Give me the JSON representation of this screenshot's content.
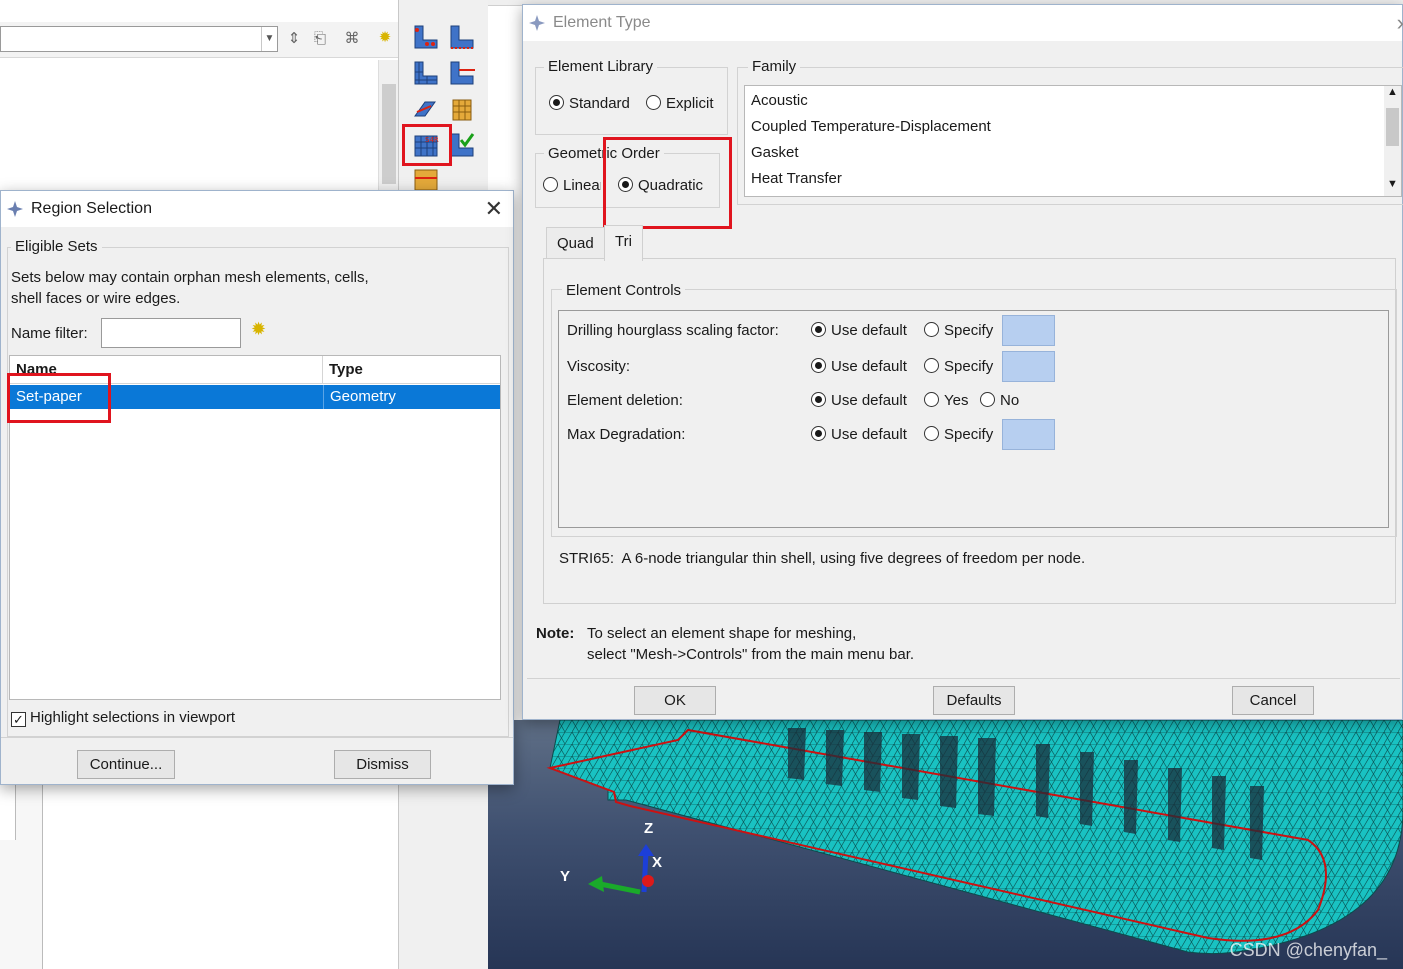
{
  "region_dialog": {
    "title": "Region Selection",
    "group_title": "Eligible Sets",
    "description_line1": "Sets below may contain orphan mesh elements, cells,",
    "description_line2": "shell faces or wire edges.",
    "name_filter_label": "Name filter:",
    "name_filter_value": "",
    "columns": [
      "Name",
      "Type"
    ],
    "rows": [
      {
        "name": "Set-paper",
        "type": "Geometry",
        "selected": true
      }
    ],
    "highlight_label": "Highlight selections in viewport",
    "highlight_checked": true,
    "continue_label": "Continue...",
    "dismiss_label": "Dismiss"
  },
  "element_dialog": {
    "title": "Element Type",
    "library_title": "Element Library",
    "library_options": [
      "Standard",
      "Explicit"
    ],
    "library_selected": "Standard",
    "family_title": "Family",
    "families": [
      "Acoustic",
      "Coupled Temperature-Displacement",
      "Gasket",
      "Heat Transfer"
    ],
    "order_title": "Geometric Order",
    "order_options": [
      "Linear",
      "Quadratic"
    ],
    "order_selected": "Quadratic",
    "tabs": [
      "Quad",
      "Tri"
    ],
    "active_tab": "Tri",
    "controls_title": "Element Controls",
    "controls": [
      {
        "label": "Drilling hourglass scaling factor:",
        "options": [
          "Use default",
          "Specify"
        ],
        "selected": "Use default",
        "value_field": true
      },
      {
        "label": "Viscosity:",
        "options": [
          "Use default",
          "Specify"
        ],
        "selected": "Use default",
        "value_field": true
      },
      {
        "label": "Element deletion:",
        "options": [
          "Use default",
          "Yes",
          "No"
        ],
        "selected": "Use default",
        "value_field": false
      },
      {
        "label": "Max Degradation:",
        "options": [
          "Use default",
          "Specify"
        ],
        "selected": "Use default",
        "value_field": true
      }
    ],
    "element_description": "STRI65:  A 6-node triangular thin shell, using five degrees of freedom per node.",
    "note_label": "Note:",
    "note_line1": "To select an element shape for meshing,",
    "note_line2": "select \"Mesh->Controls\" from the main menu bar.",
    "ok_label": "OK",
    "defaults_label": "Defaults",
    "cancel_label": "Cancel"
  },
  "viewport": {
    "axis_labels": {
      "z": "Z",
      "y": "Y",
      "x": "X"
    },
    "watermark": "CSDN @chenyfan_",
    "mesh_color": "#19c2c2",
    "background_top": "#5f6f86",
    "background_bottom": "#263555"
  },
  "highlight_color": "#e0141e",
  "selection_color": "#0a78d7"
}
